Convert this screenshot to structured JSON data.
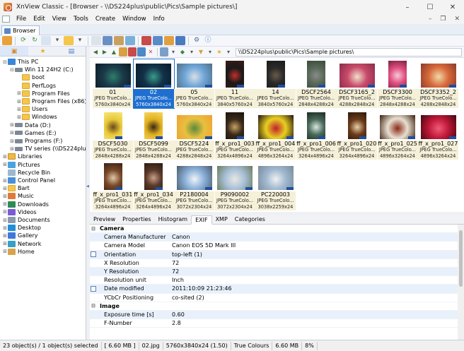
{
  "window": {
    "title": "XnView Classic - [Browser - \\\\DS224plus\\public\\Pics\\Sample pictures\\]",
    "minimize": "–",
    "maximize": "☐",
    "close": "✕"
  },
  "menu": [
    "File",
    "Edit",
    "View",
    "Tools",
    "Create",
    "Window",
    "Info"
  ],
  "mdi": {
    "minimize": "–",
    "restore": "❐",
    "close": "✕"
  },
  "tab": {
    "label": "Browser"
  },
  "address": {
    "path": "\\\\DS224plus\\public\\Pics\\Sample pictures\\"
  },
  "tree": [
    {
      "label": "This PC",
      "level": 0,
      "exp": "⊟",
      "icon": "pc"
    },
    {
      "label": "Win 11 24H2 (C:)",
      "level": 1,
      "exp": "⊟",
      "icon": "drive"
    },
    {
      "label": "boot",
      "level": 2,
      "exp": "",
      "icon": "folder"
    },
    {
      "label": "PerfLogs",
      "level": 2,
      "exp": "",
      "icon": "folder"
    },
    {
      "label": "Program Files",
      "level": 2,
      "exp": "⊞",
      "icon": "folder"
    },
    {
      "label": "Program Files (x86)",
      "level": 2,
      "exp": "⊞",
      "icon": "folder"
    },
    {
      "label": "Users",
      "level": 2,
      "exp": "⊞",
      "icon": "folder"
    },
    {
      "label": "Windows",
      "level": 2,
      "exp": "⊞",
      "icon": "folder"
    },
    {
      "label": "Data (D:)",
      "level": 1,
      "exp": "⊞",
      "icon": "drive"
    },
    {
      "label": "Games (E:)",
      "level": 1,
      "exp": "⊞",
      "icon": "drive"
    },
    {
      "label": "Programs (F:)",
      "level": 1,
      "exp": "⊞",
      "icon": "drive"
    },
    {
      "label": "TV series (\\\\DS224plus)",
      "level": 1,
      "exp": "⊞",
      "icon": "drive"
    },
    {
      "label": "Libraries",
      "level": 0,
      "exp": "⊞",
      "icon": "lib"
    },
    {
      "label": "Pictures",
      "level": 0,
      "exp": "⊞",
      "icon": "pic"
    },
    {
      "label": "Recycle Bin",
      "level": 0,
      "exp": "",
      "icon": "recycle"
    },
    {
      "label": "Control Panel",
      "level": 0,
      "exp": "⊞",
      "icon": "cp"
    },
    {
      "label": "Bart",
      "level": 0,
      "exp": "⊞",
      "icon": "folder"
    },
    {
      "label": "Music",
      "level": 0,
      "exp": "⊞",
      "icon": "music"
    },
    {
      "label": "Downloads",
      "level": 0,
      "exp": "⊞",
      "icon": "dl"
    },
    {
      "label": "Videos",
      "level": 0,
      "exp": "⊞",
      "icon": "video"
    },
    {
      "label": "Documents",
      "level": 0,
      "exp": "⊞",
      "icon": "docs"
    },
    {
      "label": "Desktop",
      "level": 0,
      "exp": "⊞",
      "icon": "desk"
    },
    {
      "label": "Gallery",
      "level": 0,
      "exp": "⊞",
      "icon": "gallery"
    },
    {
      "label": "Network",
      "level": 0,
      "exp": "⊞",
      "icon": "net"
    },
    {
      "label": "Home",
      "level": 0,
      "exp": "⊞",
      "icon": "home"
    }
  ],
  "thumbnails": [
    {
      "name": "01",
      "format": "JPEG TrueColo...",
      "dims": "5760x3840x24",
      "colors": [
        "#1b3a4a",
        "#2f7d6b",
        "#0c1c28"
      ],
      "orient": "landscape"
    },
    {
      "name": "02",
      "format": "JPEG TrueColo...",
      "dims": "5760x3840x24",
      "colors": [
        "#12324a",
        "#3a9a8a",
        "#0a1a2a"
      ],
      "orient": "landscape",
      "selected": true
    },
    {
      "name": "05",
      "format": "JPEG TrueColo...",
      "dims": "5760x3840x24",
      "colors": [
        "#6fa6d8",
        "#d8dfe6",
        "#4f6e86"
      ],
      "orient": "landscape"
    },
    {
      "name": "11",
      "format": "JPEG TrueColo...",
      "dims": "3840x5760x24",
      "colors": [
        "#1a1a1a",
        "#c2302a",
        "#3a1a14"
      ],
      "orient": "portrait"
    },
    {
      "name": "14",
      "format": "JPEG TrueColo...",
      "dims": "3840x5760x24",
      "colors": [
        "#2a2a2a",
        "#6a5a4a",
        "#1a1a1a"
      ],
      "orient": "portrait"
    },
    {
      "name": "DSCF2564",
      "format": "JPEG TrueColo...",
      "dims": "2848x4288x24",
      "colors": [
        "#5a6a5a",
        "#8a8a8a",
        "#3a4a3a"
      ],
      "orient": "portrait"
    },
    {
      "name": "DSCF3165_2",
      "format": "JPEG TrueColo...",
      "dims": "4288x2848x24",
      "colors": [
        "#c84a6a",
        "#f0e0c8",
        "#8a2a4a"
      ],
      "orient": "landscape"
    },
    {
      "name": "DSCF3300",
      "format": "JPEG TrueColo...",
      "dims": "2848x4288x24",
      "colors": [
        "#e05080",
        "#f8c8d8",
        "#7a2040"
      ],
      "orient": "portrait"
    },
    {
      "name": "DSCF3352_2",
      "format": "JPEG TrueColo...",
      "dims": "4288x2848x24",
      "colors": [
        "#d86a3a",
        "#f0d8a8",
        "#8a3a2a"
      ],
      "orient": "landscape"
    },
    {
      "name": "DSCF5030",
      "format": "JPEG TrueColo...",
      "dims": "2848x4288x24",
      "colors": [
        "#e8c83a",
        "#6a4a1a",
        "#f8e878"
      ],
      "orient": "portrait"
    },
    {
      "name": "DSCF5099",
      "format": "JPEG TrueColo...",
      "dims": "2848x4288x24",
      "colors": [
        "#e0b020",
        "#3a2a10",
        "#f8d860"
      ],
      "orient": "portrait"
    },
    {
      "name": "DSCF5224",
      "format": "JPEG TrueColo...",
      "dims": "4288x2848x24",
      "colors": [
        "#e8c040",
        "#5a8a3a",
        "#f0a030"
      ],
      "orient": "landscape"
    },
    {
      "name": "ff_x_pro1_003",
      "format": "JPEG TrueColo...",
      "dims": "3264x4896x24",
      "colors": [
        "#3a2a1a",
        "#c8a060",
        "#1a120a"
      ],
      "orient": "portrait"
    },
    {
      "name": "ff_x_pro1_004",
      "format": "JPEG TrueColo...",
      "dims": "4896x3264x24",
      "colors": [
        "#e8d020",
        "#c02030",
        "#201010"
      ],
      "orient": "landscape"
    },
    {
      "name": "ff_x_pro1_006",
      "format": "JPEG TrueColo...",
      "dims": "3264x4896x24",
      "colors": [
        "#4a6a5a",
        "#d8e8e0",
        "#1a2a20"
      ],
      "orient": "portrait"
    },
    {
      "name": "ff_x_pro1_020",
      "format": "JPEG TrueColo...",
      "dims": "3264x4896x24",
      "colors": [
        "#6a3a1a",
        "#e8d0a8",
        "#2a1a0a"
      ],
      "orient": "portrait"
    },
    {
      "name": "ff_x_pro1_025",
      "format": "JPEG TrueColo...",
      "dims": "4896x3264x24",
      "colors": [
        "#e8e0d0",
        "#8a2a1a",
        "#3a1a0a"
      ],
      "orient": "landscape"
    },
    {
      "name": "ff_x_pro1_027",
      "format": "JPEG TrueColo...",
      "dims": "4896x3264x24",
      "colors": [
        "#c01838",
        "#f05a78",
        "#400810"
      ],
      "orient": "landscape"
    },
    {
      "name": "ff_x_pro1_031",
      "format": "JPEG TrueColo...",
      "dims": "3264x4896x24",
      "colors": [
        "#7a4a2a",
        "#e0c8a8",
        "#3a2010"
      ],
      "orient": "portrait"
    },
    {
      "name": "ff_x_pro1_034",
      "format": "JPEG TrueColo...",
      "dims": "3264x4896x24",
      "colors": [
        "#5a3a2a",
        "#c8a088",
        "#2a1a10"
      ],
      "orient": "portrait"
    },
    {
      "name": "P2180004",
      "format": "JPEG TrueColo...",
      "dims": "3072x2304x24",
      "colors": [
        "#8ab0d8",
        "#f0f4f8",
        "#4a5a6a"
      ],
      "orient": "landscape"
    },
    {
      "name": "P9090002",
      "format": "JPEG TrueColo...",
      "dims": "3072x2304x24",
      "colors": [
        "#a8c0d8",
        "#e8e8e0",
        "#6a7a5a"
      ],
      "orient": "landscape"
    },
    {
      "name": "PC220003",
      "format": "JPEG TrueColo...",
      "dims": "3038x2259x24",
      "colors": [
        "#a0b8d0",
        "#f0f0f0",
        "#7a8a98"
      ],
      "orient": "landscape"
    }
  ],
  "info_tabs": [
    "Preview",
    "Properties",
    "Histogram",
    "EXIF",
    "XMP",
    "Categories"
  ],
  "info_active_tab": "EXIF",
  "exif": [
    {
      "key": "Camera",
      "value": "",
      "section": true
    },
    {
      "key": "Camera Manufacturer",
      "value": "Canon"
    },
    {
      "key": "Camera Model",
      "value": "Canon EOS 5D Mark III"
    },
    {
      "key": "Orientation",
      "value": "top-left (1)",
      "editable": true
    },
    {
      "key": "X Resolution",
      "value": "72"
    },
    {
      "key": "Y Resolution",
      "value": "72"
    },
    {
      "key": "Resolution unit",
      "value": "Inch"
    },
    {
      "key": "Date modified",
      "value": "2011:10:09 21:23:46",
      "editable": true
    },
    {
      "key": "YCbCr Positioning",
      "value": "co-sited (2)"
    },
    {
      "key": "Image",
      "value": "",
      "section": true
    },
    {
      "key": "Exposure time [s]",
      "value": "0.60"
    },
    {
      "key": "F-Number",
      "value": "2.8"
    }
  ],
  "status": [
    "23 object(s) / 1 object(s) selected",
    "[ 6.60 MB ]",
    "02.jpg",
    "5760x3840x24 (1.50)",
    "True Colours",
    "6.60 MB",
    "8%"
  ]
}
